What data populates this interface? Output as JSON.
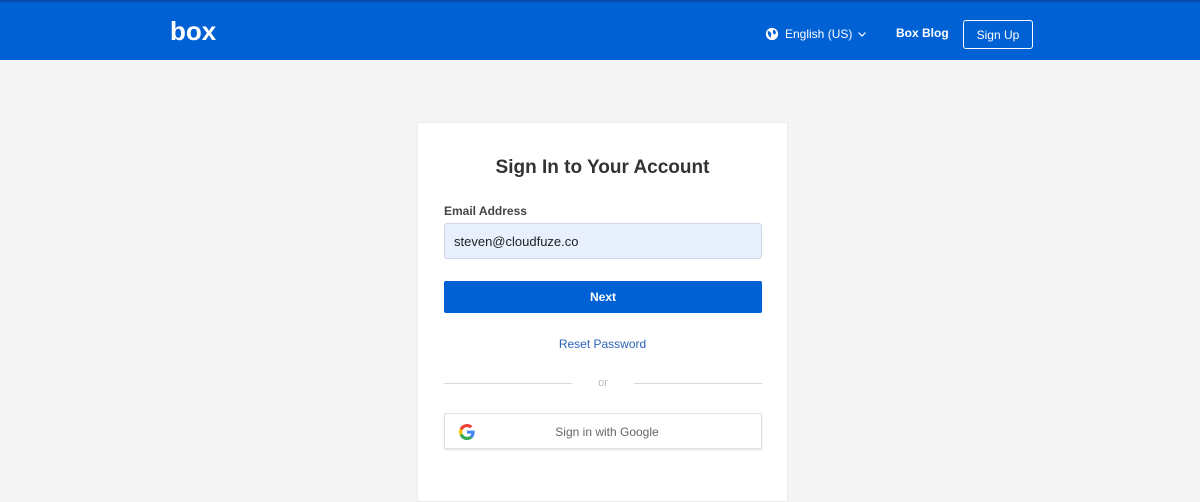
{
  "header": {
    "logo_text": "box",
    "language": "English (US)",
    "blog_link": "Box Blog",
    "signup_label": "Sign Up"
  },
  "login": {
    "title": "Sign In to Your Account",
    "email_label": "Email Address",
    "email_value": "steven@cloudfuze.co",
    "next_label": "Next",
    "reset_label": "Reset Password",
    "divider_text": "or",
    "google_label": "Sign in with Google"
  },
  "colors": {
    "brand_blue": "#0061d5",
    "page_bg": "#f4f4f4",
    "link_blue": "#2a62b9",
    "autofill_bg": "#e8f0fe"
  },
  "icons": {
    "language": "globe-icon",
    "dropdown": "chevron-down-icon",
    "google": "google-g-icon"
  }
}
